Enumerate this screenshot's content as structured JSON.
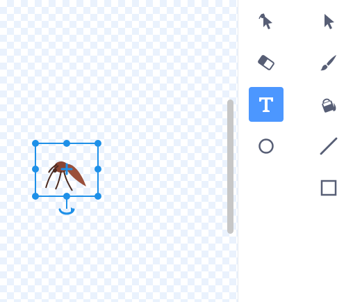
{
  "editor": {
    "canvas": {
      "selected_sprite": "mosquito"
    },
    "tools": [
      {
        "id": "reshape",
        "icon": "reshape-icon",
        "selected": false
      },
      {
        "id": "select",
        "icon": "select-arrow-icon",
        "selected": false
      },
      {
        "id": "eraser",
        "icon": "eraser-icon",
        "selected": false
      },
      {
        "id": "brush",
        "icon": "brush-icon",
        "selected": false
      },
      {
        "id": "text",
        "icon": "text-icon",
        "label": "T",
        "selected": true
      },
      {
        "id": "fill",
        "icon": "fill-bucket-icon",
        "selected": false
      },
      {
        "id": "circle",
        "icon": "circle-icon",
        "selected": false
      },
      {
        "id": "line",
        "icon": "line-icon",
        "selected": false
      },
      {
        "id": "rectangle",
        "icon": "rectangle-icon",
        "selected": false
      }
    ],
    "colors": {
      "accent": "#4c97ff",
      "selection": "#1e90e8",
      "icon": "#575e75",
      "checker": "#eaf2fd",
      "sprite": "#9a4f3a"
    }
  }
}
